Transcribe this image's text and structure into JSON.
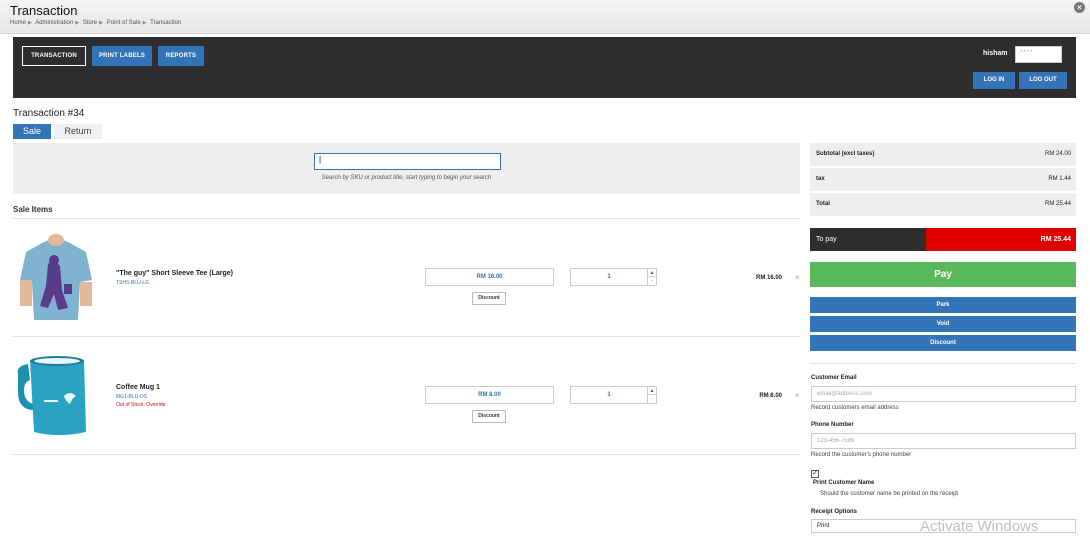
{
  "window": {
    "title": "Transaction",
    "breadcrumbs": [
      "Home",
      "Administration",
      "Store",
      "Point of Sale",
      "Transaction"
    ]
  },
  "nav": {
    "items": [
      "TRANSACTION",
      "PRINT LABELS",
      "REPORTS"
    ],
    "active": "TRANSACTION"
  },
  "auth": {
    "username": "hisham",
    "password_mask": "****",
    "login_label": "LOG IN",
    "logout_label": "LOG OUT"
  },
  "transaction": {
    "title": "Transaction #34",
    "tabs": [
      "Sale",
      "Return"
    ],
    "active_tab": "Sale"
  },
  "search": {
    "value": "|",
    "hint": "Search by SKU or product title, start typing to begin your search"
  },
  "sale_items": {
    "title": "Sale Items",
    "items": [
      {
        "name": "\"The guy\" Short Sleeve Tee (Large)",
        "sku": "TSHS-BLU-LG",
        "stock_note": "",
        "price": "RM 16.00",
        "discount_label": "Discount",
        "qty": "1",
        "line_total": "RM 16.00",
        "image_icon": "tshirt-image"
      },
      {
        "name": "Coffee Mug 1",
        "sku": "MG1-BLU-OS",
        "stock_note": "Out of Stock: Override",
        "price": "RM 8.00",
        "discount_label": "Discount",
        "qty": "1",
        "line_total": "RM 8.00",
        "image_icon": "mug-image"
      }
    ]
  },
  "summary": {
    "subtotal_label": "Subtotal (excl taxes)",
    "subtotal": "RM 24.00",
    "tax_label": "tax",
    "tax": "RM 1.44",
    "total_label": "Total",
    "total": "RM 25.44",
    "to_pay_label": "To pay",
    "to_pay": "RM 25.44"
  },
  "actions": {
    "pay": "Pay",
    "park": "Park",
    "void": "Void",
    "discount": "Discount"
  },
  "customer": {
    "email_label": "Customer Email",
    "email_placeholder": "email@address.com",
    "email_help": "Record customers email address",
    "phone_label": "Phone Number",
    "phone_placeholder": "123-456-7589",
    "phone_help": "Record the customer's phone number",
    "print_name_checked": true,
    "print_name_label": "Print Customer Name",
    "print_name_help": "Should the customer name be printed on the receipt",
    "receipt_label": "Receipt Options",
    "receipt_value": "Print"
  },
  "watermark": "Activate Windows",
  "colors": {
    "primary": "#3374b8",
    "dark": "#2e2e2e",
    "pay": "#5cb85c",
    "to_pay": "#e00000"
  }
}
